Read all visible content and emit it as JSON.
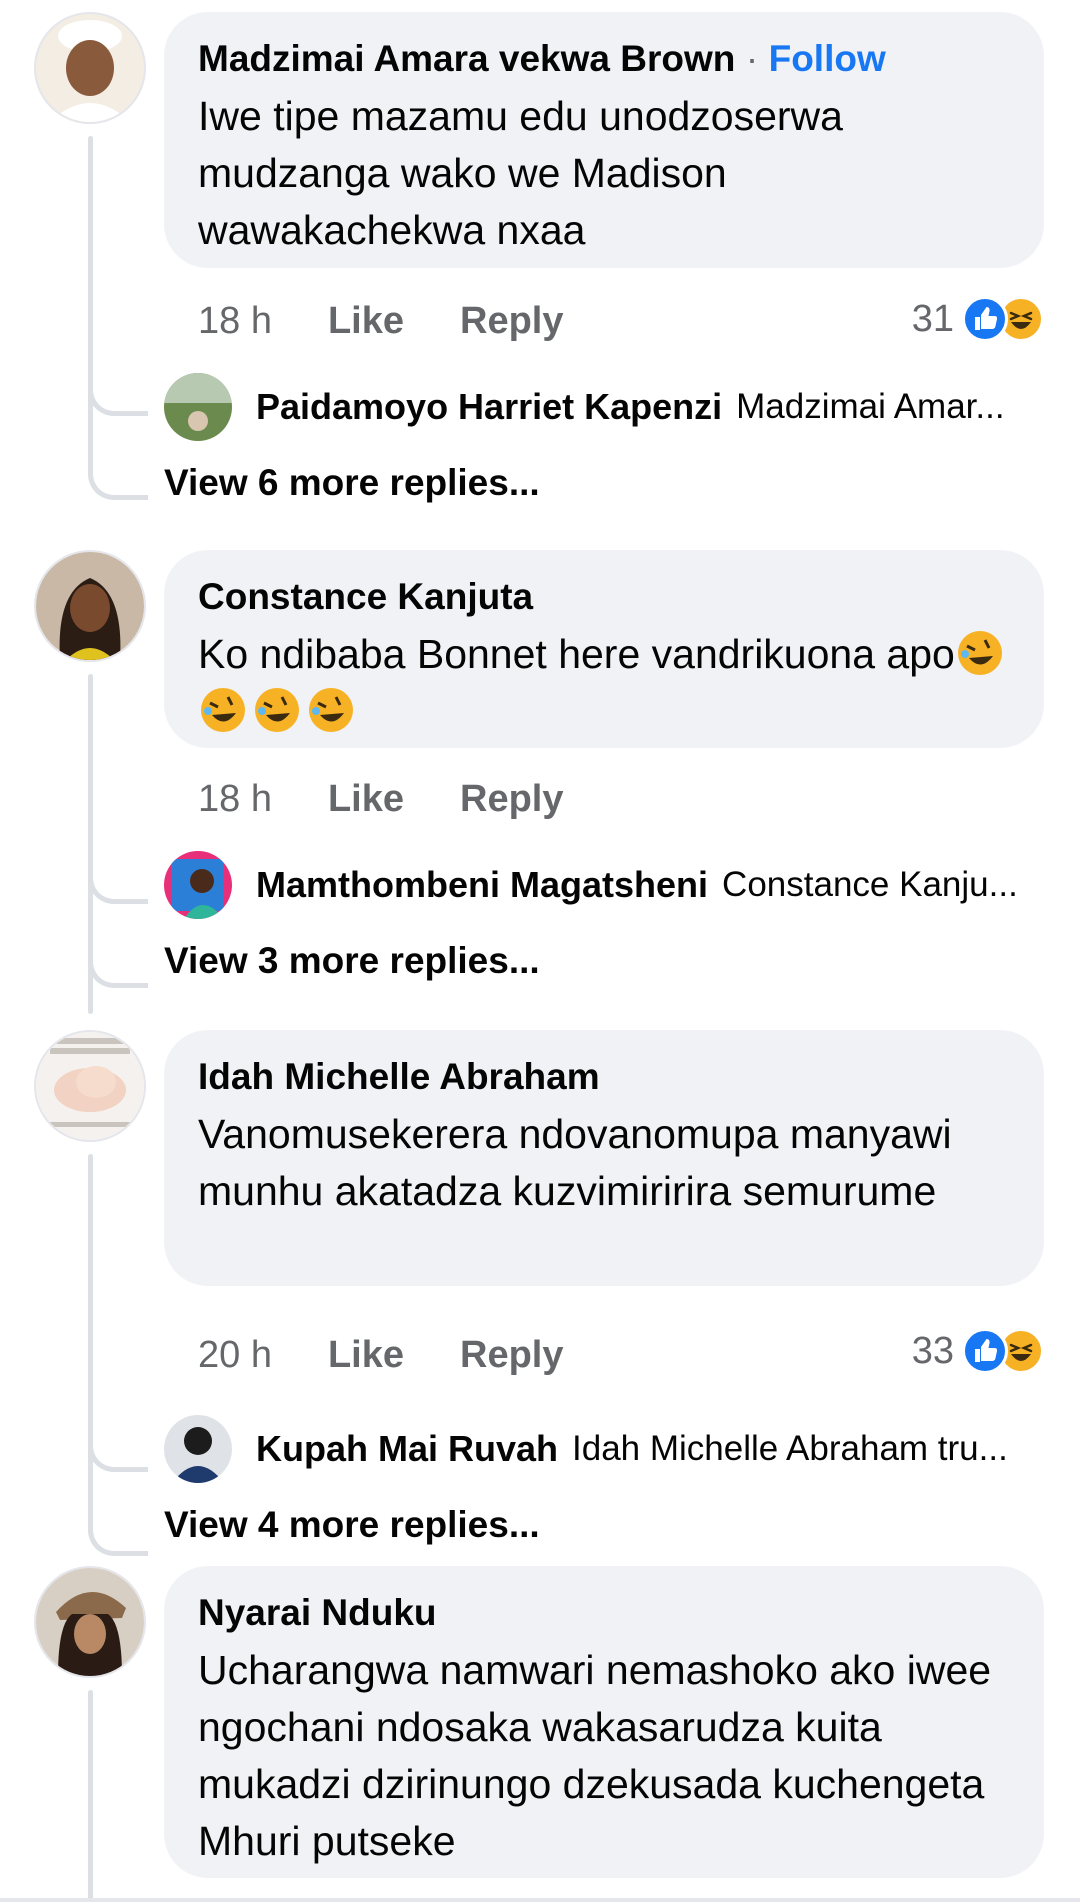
{
  "colors": {
    "link": "#1877f2",
    "bubble": "#f0f2f5",
    "meta": "#65676b"
  },
  "comments": [
    {
      "author": "Madzimai Amara vekwa Brown",
      "follow_sep": "·",
      "follow_label": "Follow",
      "text": "Iwe tipe mazamu edu unodzoserwa mudzanga wako we Madison wawakachekwa nxaa",
      "time": "18 h",
      "like_label": "Like",
      "reply_label": "Reply",
      "reaction_count": "31",
      "reactions": [
        "like-icon",
        "haha-icon"
      ],
      "reply_preview": {
        "name": "Paidamoyo Harriet Kapenzi",
        "snippet": "Madzimai Amar..."
      },
      "more_replies": "View 6 more replies..."
    },
    {
      "author": "Constance Kanjuta",
      "text": "Ko ndibaba Bonnet here vandrikuona apo",
      "emojis": [
        "rolling-laughing-emoji",
        "rolling-laughing-emoji",
        "rolling-laughing-emoji",
        "rolling-laughing-emoji"
      ],
      "time": "18 h",
      "like_label": "Like",
      "reply_label": "Reply",
      "reply_preview": {
        "name": "Mamthombeni Magatsheni",
        "snippet": "Constance Kanju..."
      },
      "more_replies": "View 3 more replies..."
    },
    {
      "author": "Idah Michelle Abraham",
      "text": "Vanomusekerera ndovanomupa manyawi munhu akatadza kuzvimiririra semurume",
      "time": "20 h",
      "like_label": "Like",
      "reply_label": "Reply",
      "reaction_count": "33",
      "reactions": [
        "like-icon",
        "haha-icon"
      ],
      "reply_preview": {
        "name": "Kupah Mai Ruvah",
        "snippet": "Idah Michelle Abraham tru..."
      },
      "more_replies": "View 4 more replies..."
    },
    {
      "author": "Nyarai Nduku",
      "text": "Ucharangwa namwari nemashoko ako iwee  ngochani ndosaka wakasarudza kuita mukadzi dzirinungo dzekusada kuchengeta Mhuri putseke"
    }
  ]
}
